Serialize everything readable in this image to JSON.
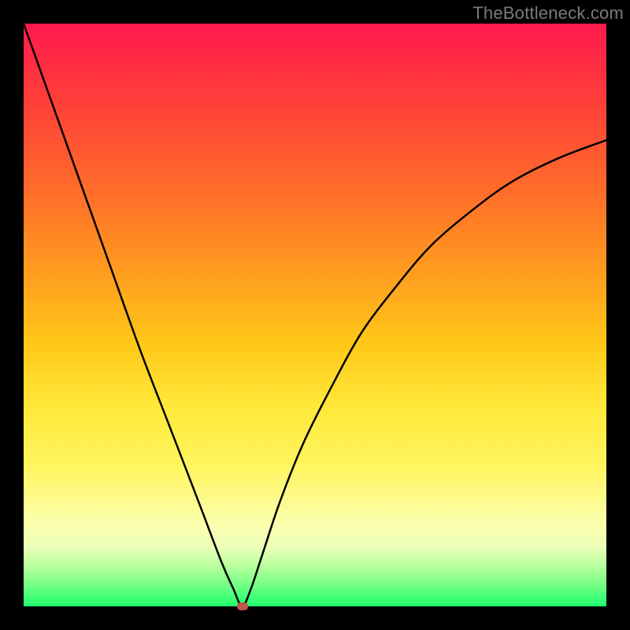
{
  "watermark": "TheBottleneck.com",
  "colors": {
    "frame": "#000000",
    "curve": "#000000",
    "marker": "#c0564c"
  },
  "chart_data": {
    "type": "line",
    "title": "",
    "xlabel": "",
    "ylabel": "",
    "xlim": [
      0,
      100
    ],
    "ylim": [
      0,
      100
    ],
    "grid": false,
    "legend": false,
    "x": [
      0,
      5,
      10,
      15,
      20,
      25,
      30,
      34,
      36,
      37.5,
      39,
      41,
      44,
      48,
      53,
      58,
      64,
      70,
      77,
      84,
      92,
      100
    ],
    "values": [
      100,
      86,
      72,
      58,
      44,
      31,
      18,
      7.5,
      3,
      0,
      3,
      9,
      18,
      28,
      38,
      47,
      55,
      62,
      68,
      73,
      77,
      80
    ],
    "marker": {
      "x": 37.5,
      "y": 0
    },
    "background_gradient": {
      "stops": [
        {
          "pos": 0,
          "color": "#ff1a4d"
        },
        {
          "pos": 12,
          "color": "#ff3b3b"
        },
        {
          "pos": 28,
          "color": "#ff6a2a"
        },
        {
          "pos": 42,
          "color": "#ff9a1f"
        },
        {
          "pos": 55,
          "color": "#ffc818"
        },
        {
          "pos": 66,
          "color": "#ffe93a"
        },
        {
          "pos": 76,
          "color": "#fff560"
        },
        {
          "pos": 86,
          "color": "#fcffae"
        },
        {
          "pos": 90,
          "color": "#e9ffb8"
        },
        {
          "pos": 93,
          "color": "#b9ff9e"
        },
        {
          "pos": 96,
          "color": "#7bff86"
        },
        {
          "pos": 100,
          "color": "#1fff6e"
        }
      ]
    }
  }
}
